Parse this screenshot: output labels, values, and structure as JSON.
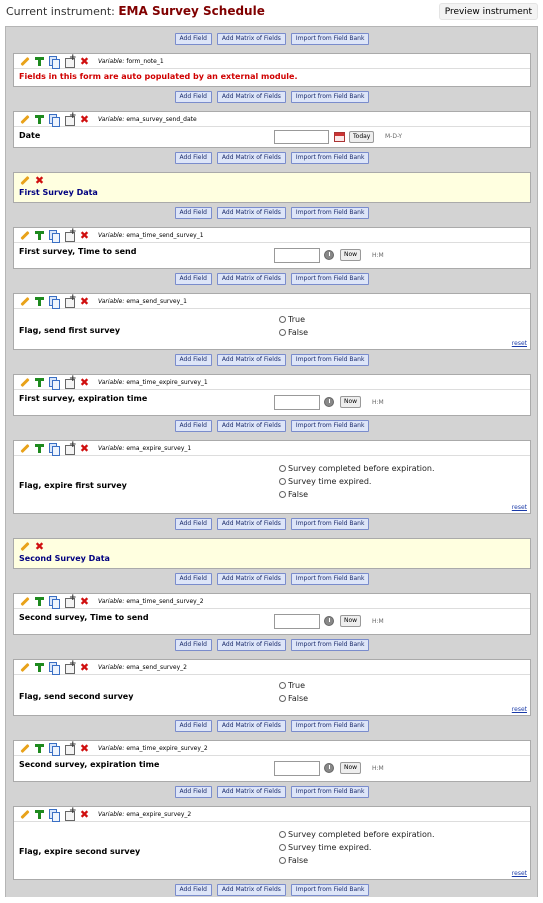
{
  "header": {
    "label": "Current instrument:",
    "title": "EMA Survey Schedule",
    "preview": "Preview instrument"
  },
  "buttons": {
    "add_field": "Add Field",
    "add_matrix": "Add Matrix of Fields",
    "import_bank": "Import from Field Bank"
  },
  "common": {
    "variable_label": "Variable:",
    "today": "Today",
    "now": "Now",
    "mdy": "M-D-Y",
    "hm": "H:M",
    "reset": "reset"
  },
  "fields": [
    {
      "kind": "note",
      "variable": "form_note_1",
      "note": "Fields in this form are auto populated by an external module."
    },
    {
      "kind": "date",
      "variable": "ema_survey_send_date",
      "label": "Date"
    },
    {
      "kind": "section",
      "label": "First Survey Data"
    },
    {
      "kind": "time",
      "variable": "ema_time_send_survey_1",
      "label": "First survey, Time to send"
    },
    {
      "kind": "radio2",
      "variable": "ema_send_survey_1",
      "label": "Flag, send first survey",
      "options": [
        "True",
        "False"
      ]
    },
    {
      "kind": "time",
      "variable": "ema_time_expire_survey_1",
      "label": "First survey, expiration time"
    },
    {
      "kind": "radio3",
      "variable": "ema_expire_survey_1",
      "label": "Flag, expire first survey",
      "options": [
        "Survey completed before expiration.",
        "Survey time expired.",
        "False"
      ]
    },
    {
      "kind": "section",
      "label": "Second Survey Data"
    },
    {
      "kind": "time",
      "variable": "ema_time_send_survey_2",
      "label": "Second survey, Time to send"
    },
    {
      "kind": "radio2",
      "variable": "ema_send_survey_2",
      "label": "Flag, send second survey",
      "options": [
        "True",
        "False"
      ]
    },
    {
      "kind": "time",
      "variable": "ema_time_expire_survey_2",
      "label": "Second survey, expiration time"
    },
    {
      "kind": "radio3",
      "variable": "ema_expire_survey_2",
      "label": "Flag, expire second survey",
      "options": [
        "Survey completed before expiration.",
        "Survey time expired.",
        "False"
      ]
    }
  ]
}
